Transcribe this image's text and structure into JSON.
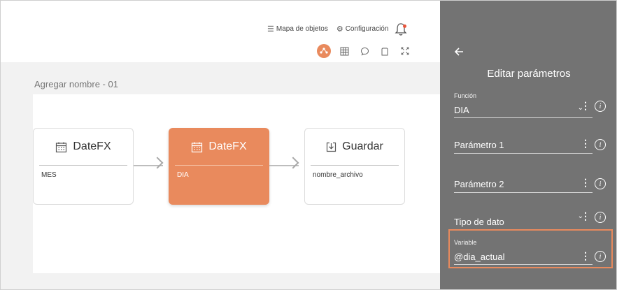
{
  "topnav": {
    "objects_map": "Mapa de objetos",
    "settings": "Configuración"
  },
  "workspace": {
    "title": "Agregar nombre - 01",
    "nodes": [
      {
        "title": "DateFX",
        "param": "MES",
        "icon": "calendar-icon",
        "active": false
      },
      {
        "title": "DateFX",
        "param": "DIA",
        "icon": "calendar-icon",
        "active": true
      },
      {
        "title": "Guardar",
        "param": "nombre_archivo",
        "icon": "save-download-icon",
        "active": false
      }
    ]
  },
  "panel": {
    "title": "Editar parámetros",
    "fields": {
      "funcion": {
        "label": "Función",
        "value": "DIA"
      },
      "param1": {
        "placeholder": "Parámetro 1"
      },
      "param2": {
        "placeholder": "Parámetro 2"
      },
      "tipo": {
        "placeholder": "Tipo de dato"
      },
      "variable": {
        "label": "Variable",
        "value": "@dia_actual"
      }
    },
    "info_glyph": "i"
  },
  "colors": {
    "accent": "#e98a5d",
    "panel_bg": "#737373",
    "workspace_bg": "#f2f2f2"
  }
}
